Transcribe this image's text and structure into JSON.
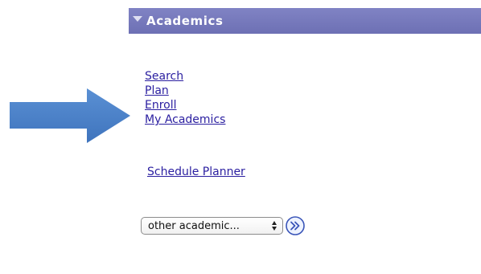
{
  "section": {
    "title": "Academics"
  },
  "links": [
    {
      "label": "Search"
    },
    {
      "label": "Plan"
    },
    {
      "label": "Enroll"
    },
    {
      "label": "My Academics"
    }
  ],
  "schedule_planner": {
    "label": "Schedule Planner"
  },
  "academic_select": {
    "value": "other academic..."
  },
  "icons": {
    "toggle": "collapse-triangle-icon",
    "arrow": "right-arrow-icon",
    "go": "double-chevron-right-icon"
  },
  "colors": {
    "header_bar": "#7376bb",
    "link": "#2a1ea0",
    "arrow": "#4a7fc4",
    "go_button": "#3a55b8"
  }
}
